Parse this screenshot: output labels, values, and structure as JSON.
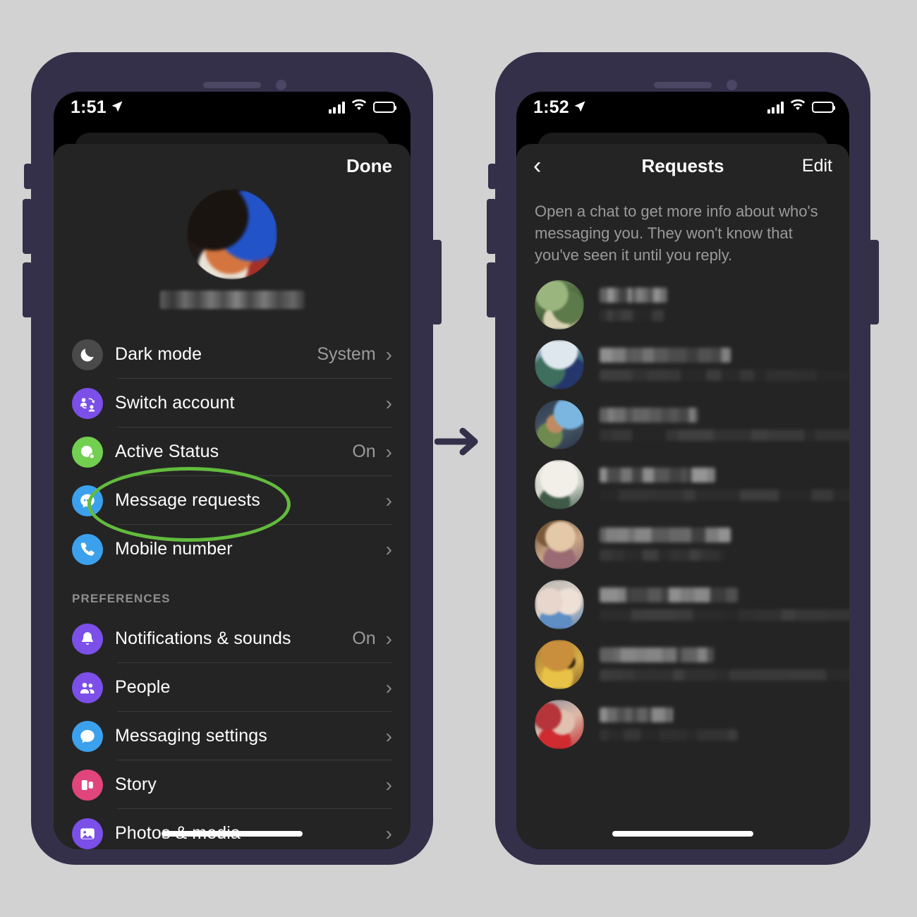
{
  "background_color": "#d2d2d2",
  "frame_color": "#343049",
  "arrow": {
    "name": "right-arrow",
    "color": "#343049"
  },
  "left_phone": {
    "status_bar": {
      "time": "1:51",
      "location_icon": "location-arrow-icon",
      "signal_icon": "cellular-bars-icon",
      "wifi_icon": "wifi-icon",
      "battery_icon": "battery-icon",
      "battery_level": 52
    },
    "sheet": {
      "done_label": "Done",
      "profile": {
        "avatar": "profile-avatar-redacted",
        "name_redacted": true
      }
    },
    "items": [
      {
        "label": "Dark mode",
        "value": "System",
        "icon": "moon-icon",
        "icon_color": "#4a4a4a",
        "chevron": "›"
      },
      {
        "label": "Switch account",
        "value": "",
        "icon": "switch-account-icon",
        "icon_color": "#7b4fe8",
        "chevron": "›"
      },
      {
        "label": "Active Status",
        "value": "On",
        "icon": "active-status-icon",
        "icon_color": "#73cf4f",
        "chevron": "›"
      },
      {
        "label": "Message requests",
        "value": "",
        "icon": "message-requests-icon",
        "icon_color": "#3ba1ed",
        "chevron": "›",
        "highlighted": true
      },
      {
        "label": "Mobile number",
        "value": "",
        "icon": "phone-icon",
        "icon_color": "#3ba1ed",
        "chevron": "›"
      }
    ],
    "preferences_header": "PREFERENCES",
    "preferences": [
      {
        "label": "Notifications & sounds",
        "value": "On",
        "icon": "bell-icon",
        "icon_color": "#7b4fe8",
        "chevron": "›"
      },
      {
        "label": "People",
        "value": "",
        "icon": "people-icon",
        "icon_color": "#7b4fe8",
        "chevron": "›"
      },
      {
        "label": "Messaging settings",
        "value": "",
        "icon": "chat-bubble-icon",
        "icon_color": "#3ba1ed",
        "chevron": "›"
      },
      {
        "label": "Story",
        "value": "",
        "icon": "story-icon",
        "icon_color": "#e0457b",
        "chevron": "›"
      },
      {
        "label": "Photos & media",
        "value": "",
        "icon": "photo-icon",
        "icon_color": "#7b4fe8",
        "chevron": "›"
      }
    ],
    "highlight": {
      "color": "#62bb3e",
      "target": "Message requests"
    }
  },
  "right_phone": {
    "status_bar": {
      "time": "1:52",
      "location_icon": "location-arrow-icon",
      "signal_icon": "cellular-bars-icon",
      "wifi_icon": "wifi-icon",
      "battery_icon": "battery-icon",
      "battery_level": 52
    },
    "nav": {
      "back_icon": "chevron-left-icon",
      "title": "Requests",
      "edit_label": "Edit"
    },
    "description": "Open a chat to get more info about who's messaging you. They won't know that you've seen it until you reply.",
    "requests": [
      {
        "avatar": "avatar-1-green",
        "name_redacted": true,
        "preview_redacted": true,
        "name_w": 96,
        "sub_w": 92
      },
      {
        "avatar": "avatar-2-blue",
        "name_redacted": true,
        "preview_redacted": true,
        "name_w": 186,
        "sub_w": 352
      },
      {
        "avatar": "avatar-3-dark",
        "name_redacted": true,
        "preview_redacted": true,
        "name_w": 140,
        "sub_w": 362
      },
      {
        "avatar": "avatar-4-white",
        "name_redacted": true,
        "preview_redacted": true,
        "name_w": 164,
        "sub_w": 372
      },
      {
        "avatar": "avatar-5-tan",
        "name_redacted": true,
        "preview_redacted": true,
        "name_w": 186,
        "sub_w": 178
      },
      {
        "avatar": "avatar-6-pale",
        "name_redacted": true,
        "preview_redacted": true,
        "name_w": 196,
        "sub_w": 358
      },
      {
        "avatar": "avatar-7-gold",
        "name_redacted": true,
        "preview_redacted": true,
        "name_w": 162,
        "sub_w": 368
      },
      {
        "avatar": "avatar-8-red",
        "name_redacted": true,
        "preview_redacted": true,
        "name_w": 104,
        "sub_w": 196
      }
    ]
  }
}
